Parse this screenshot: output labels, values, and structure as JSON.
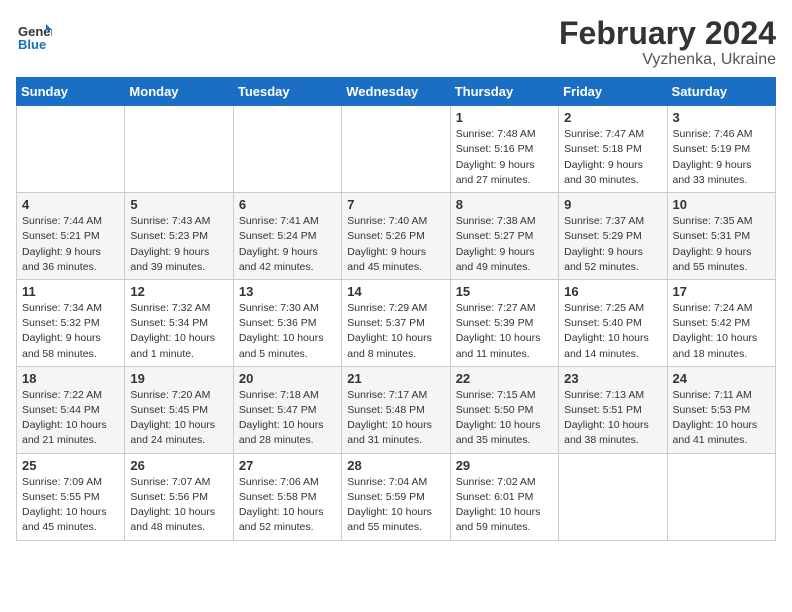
{
  "header": {
    "logo_general": "General",
    "logo_blue": "Blue",
    "title": "February 2024",
    "subtitle": "Vyzhenka, Ukraine"
  },
  "weekdays": [
    "Sunday",
    "Monday",
    "Tuesday",
    "Wednesday",
    "Thursday",
    "Friday",
    "Saturday"
  ],
  "weeks": [
    [
      {
        "day": "",
        "info": ""
      },
      {
        "day": "",
        "info": ""
      },
      {
        "day": "",
        "info": ""
      },
      {
        "day": "",
        "info": ""
      },
      {
        "day": "1",
        "info": "Sunrise: 7:48 AM\nSunset: 5:16 PM\nDaylight: 9 hours\nand 27 minutes."
      },
      {
        "day": "2",
        "info": "Sunrise: 7:47 AM\nSunset: 5:18 PM\nDaylight: 9 hours\nand 30 minutes."
      },
      {
        "day": "3",
        "info": "Sunrise: 7:46 AM\nSunset: 5:19 PM\nDaylight: 9 hours\nand 33 minutes."
      }
    ],
    [
      {
        "day": "4",
        "info": "Sunrise: 7:44 AM\nSunset: 5:21 PM\nDaylight: 9 hours\nand 36 minutes."
      },
      {
        "day": "5",
        "info": "Sunrise: 7:43 AM\nSunset: 5:23 PM\nDaylight: 9 hours\nand 39 minutes."
      },
      {
        "day": "6",
        "info": "Sunrise: 7:41 AM\nSunset: 5:24 PM\nDaylight: 9 hours\nand 42 minutes."
      },
      {
        "day": "7",
        "info": "Sunrise: 7:40 AM\nSunset: 5:26 PM\nDaylight: 9 hours\nand 45 minutes."
      },
      {
        "day": "8",
        "info": "Sunrise: 7:38 AM\nSunset: 5:27 PM\nDaylight: 9 hours\nand 49 minutes."
      },
      {
        "day": "9",
        "info": "Sunrise: 7:37 AM\nSunset: 5:29 PM\nDaylight: 9 hours\nand 52 minutes."
      },
      {
        "day": "10",
        "info": "Sunrise: 7:35 AM\nSunset: 5:31 PM\nDaylight: 9 hours\nand 55 minutes."
      }
    ],
    [
      {
        "day": "11",
        "info": "Sunrise: 7:34 AM\nSunset: 5:32 PM\nDaylight: 9 hours\nand 58 minutes."
      },
      {
        "day": "12",
        "info": "Sunrise: 7:32 AM\nSunset: 5:34 PM\nDaylight: 10 hours\nand 1 minute."
      },
      {
        "day": "13",
        "info": "Sunrise: 7:30 AM\nSunset: 5:36 PM\nDaylight: 10 hours\nand 5 minutes."
      },
      {
        "day": "14",
        "info": "Sunrise: 7:29 AM\nSunset: 5:37 PM\nDaylight: 10 hours\nand 8 minutes."
      },
      {
        "day": "15",
        "info": "Sunrise: 7:27 AM\nSunset: 5:39 PM\nDaylight: 10 hours\nand 11 minutes."
      },
      {
        "day": "16",
        "info": "Sunrise: 7:25 AM\nSunset: 5:40 PM\nDaylight: 10 hours\nand 14 minutes."
      },
      {
        "day": "17",
        "info": "Sunrise: 7:24 AM\nSunset: 5:42 PM\nDaylight: 10 hours\nand 18 minutes."
      }
    ],
    [
      {
        "day": "18",
        "info": "Sunrise: 7:22 AM\nSunset: 5:44 PM\nDaylight: 10 hours\nand 21 minutes."
      },
      {
        "day": "19",
        "info": "Sunrise: 7:20 AM\nSunset: 5:45 PM\nDaylight: 10 hours\nand 24 minutes."
      },
      {
        "day": "20",
        "info": "Sunrise: 7:18 AM\nSunset: 5:47 PM\nDaylight: 10 hours\nand 28 minutes."
      },
      {
        "day": "21",
        "info": "Sunrise: 7:17 AM\nSunset: 5:48 PM\nDaylight: 10 hours\nand 31 minutes."
      },
      {
        "day": "22",
        "info": "Sunrise: 7:15 AM\nSunset: 5:50 PM\nDaylight: 10 hours\nand 35 minutes."
      },
      {
        "day": "23",
        "info": "Sunrise: 7:13 AM\nSunset: 5:51 PM\nDaylight: 10 hours\nand 38 minutes."
      },
      {
        "day": "24",
        "info": "Sunrise: 7:11 AM\nSunset: 5:53 PM\nDaylight: 10 hours\nand 41 minutes."
      }
    ],
    [
      {
        "day": "25",
        "info": "Sunrise: 7:09 AM\nSunset: 5:55 PM\nDaylight: 10 hours\nand 45 minutes."
      },
      {
        "day": "26",
        "info": "Sunrise: 7:07 AM\nSunset: 5:56 PM\nDaylight: 10 hours\nand 48 minutes."
      },
      {
        "day": "27",
        "info": "Sunrise: 7:06 AM\nSunset: 5:58 PM\nDaylight: 10 hours\nand 52 minutes."
      },
      {
        "day": "28",
        "info": "Sunrise: 7:04 AM\nSunset: 5:59 PM\nDaylight: 10 hours\nand 55 minutes."
      },
      {
        "day": "29",
        "info": "Sunrise: 7:02 AM\nSunset: 6:01 PM\nDaylight: 10 hours\nand 59 minutes."
      },
      {
        "day": "",
        "info": ""
      },
      {
        "day": "",
        "info": ""
      }
    ]
  ]
}
